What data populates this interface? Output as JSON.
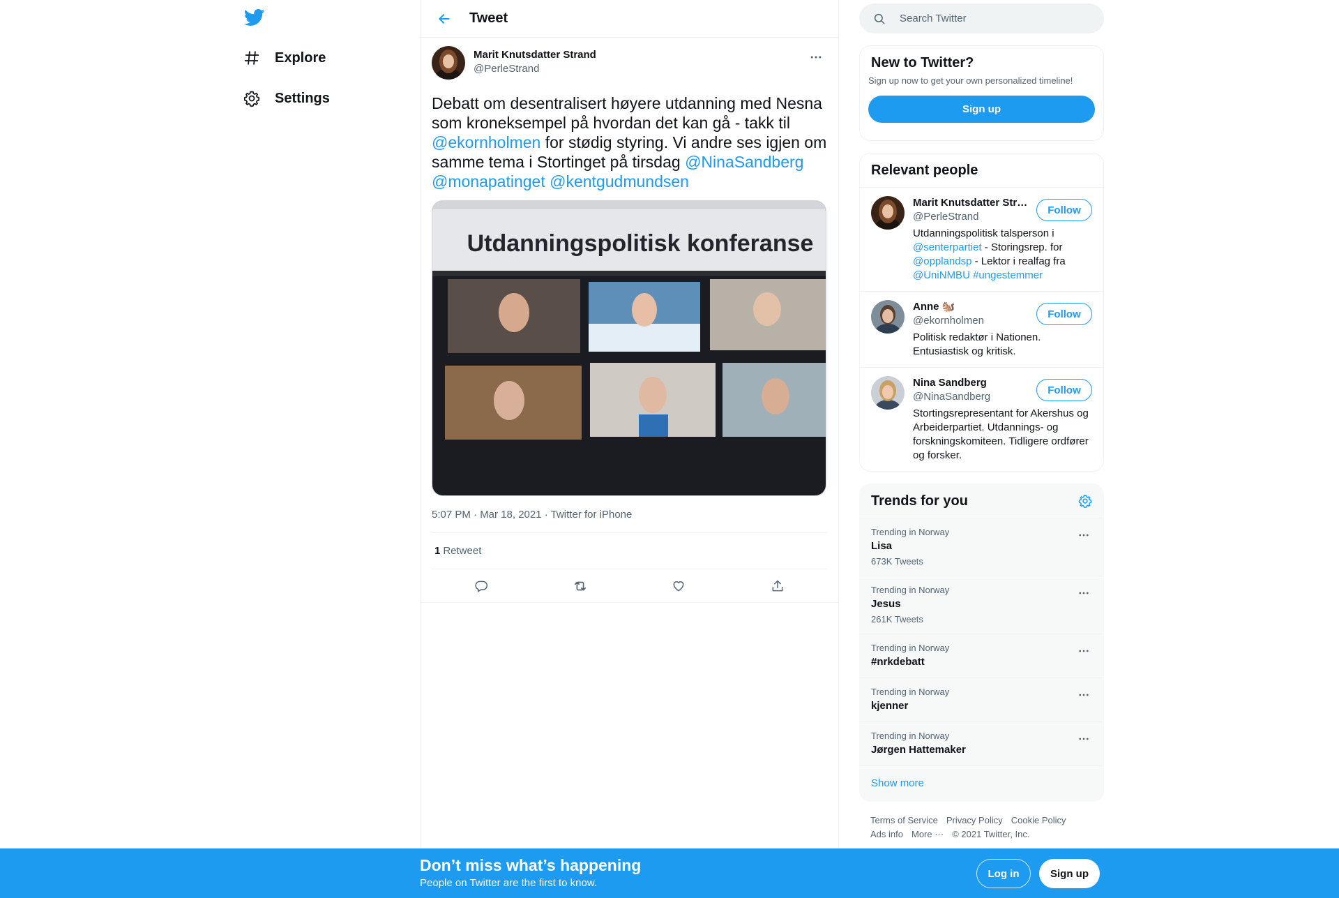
{
  "nav": {
    "items": [
      {
        "label": "Explore",
        "icon": "hashtag-icon"
      },
      {
        "label": "Settings",
        "icon": "gear-icon"
      }
    ]
  },
  "header": {
    "title": "Tweet"
  },
  "tweet": {
    "author_name": "Marit Knutsdatter Strand",
    "author_handle": "@PerleStrand",
    "text_1": "Debatt om desentralisert høyere utdanning med Nesna som kroneksempel på hvordan det kan gå - takk til ",
    "mention_1": "@ekornholmen",
    "text_2": " for stødig styring. Vi andre ses igjen om samme tema i Stortinget på tirsdag ",
    "mention_2": "@NinaSandberg",
    "mention_3": "@monapatinget",
    "mention_4": "@kentgudmundsen",
    "media_title": "Utdanningspolitisk konferanse",
    "meta": "5:07 PM · Mar 18, 2021 · Twitter for iPhone",
    "retweet_count": "1",
    "retweet_label": "Retweet"
  },
  "search": {
    "placeholder": "Search Twitter"
  },
  "new_to_twitter": {
    "title": "New to Twitter?",
    "subtitle": "Sign up now to get your own personalized timeline!",
    "button": "Sign up"
  },
  "relevant_people": {
    "title": "Relevant people",
    "follow_label": "Follow",
    "people": [
      {
        "name": "Marit Knutsdatter Strand",
        "handle": "@PerleStrand",
        "bio_1": "Utdanningspolitisk talsperson i ",
        "bio_m1": "@senterpartiet",
        "bio_2": " - Storingsrep. for ",
        "bio_m2": "@opplandsp",
        "bio_3": " - Lektor i realfag fra ",
        "bio_m3": "@UniNMBU",
        "bio_m4": "#ungestemmer"
      },
      {
        "name": "Anne 🐿️",
        "handle": "@ekornholmen",
        "bio": "Politisk redaktør i Nationen. Entusiastisk og kritisk."
      },
      {
        "name": "Nina Sandberg",
        "handle": "@NinaSandberg",
        "bio": "Stortingsrepresentant for Akershus og Arbeiderpartiet. Utdannings- og forskningskomiteen. Tidligere ordfører og forsker."
      }
    ]
  },
  "trends": {
    "title": "Trends for you",
    "items": [
      {
        "context": "Trending in Norway",
        "name": "Lisa",
        "count": "673K Tweets"
      },
      {
        "context": "Trending in Norway",
        "name": "Jesus",
        "count": "261K Tweets"
      },
      {
        "context": "Trending in Norway",
        "name": "#nrkdebatt"
      },
      {
        "context": "Trending in Norway",
        "name": "kjenner"
      },
      {
        "context": "Trending in Norway",
        "name": "Jørgen Hattemaker"
      }
    ],
    "show_more": "Show more"
  },
  "footer": {
    "links": [
      "Terms of Service",
      "Privacy Policy",
      "Cookie Policy",
      "Ads info",
      "More ···"
    ],
    "copyright": "© 2021 Twitter, Inc."
  },
  "bottom_bar": {
    "title": "Don’t miss what’s happening",
    "subtitle": "People on Twitter are the first to know.",
    "login": "Log in",
    "signup": "Sign up"
  },
  "colors": {
    "accent": "#1d9bf0",
    "text": "#0f1419",
    "muted": "#536471",
    "border": "#eff3f4"
  }
}
